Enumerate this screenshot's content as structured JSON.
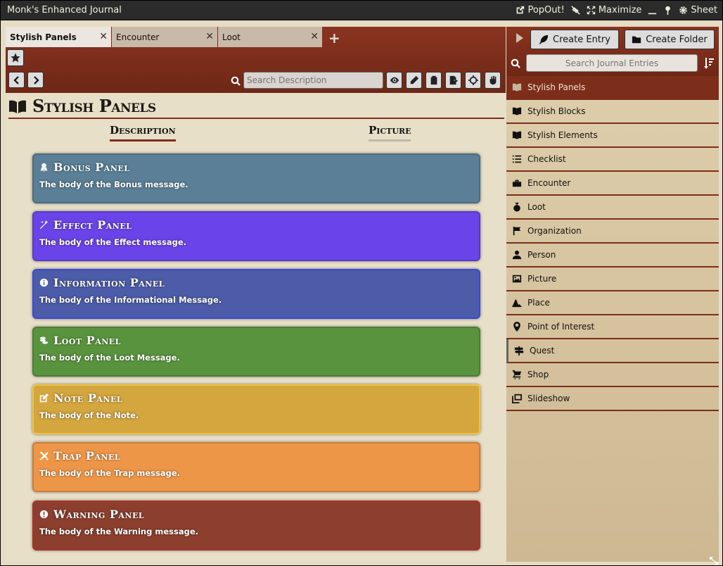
{
  "window": {
    "title": "Monk's Enhanced Journal",
    "header_buttons": [
      "PopOut!",
      "",
      "Maximize",
      "",
      "",
      "Sheet"
    ]
  },
  "tabs": [
    {
      "label": "Stylish Panels"
    },
    {
      "label": "Encounter"
    },
    {
      "label": "Loot"
    }
  ],
  "toolbar": {
    "search_placeholder": "Search Description"
  },
  "page": {
    "title": "Stylish Panels",
    "subtabs": [
      {
        "label": "Description"
      },
      {
        "label": "Picture"
      }
    ]
  },
  "panels": [
    {
      "title": "Bonus Panel",
      "body": "The body of the Bonus message.",
      "color": "#5a7f96",
      "icon": "ribbon-icon"
    },
    {
      "title": "Effect Panel",
      "body": "The body of the Effect message.",
      "color": "#6a44e8",
      "icon": "magic-wand-icon"
    },
    {
      "title": "Information Panel",
      "body": "The body of the Informational Message.",
      "color": "#4d5ca8",
      "icon": "info-icon"
    },
    {
      "title": "Loot Panel",
      "body": "The body of the Loot Message.",
      "color": "#5a933e",
      "icon": "coins-icon"
    },
    {
      "title": "Note Panel",
      "body": "The body of the Note.",
      "color": "#d4a63e",
      "icon": "edit-icon"
    },
    {
      "title": "Trap Panel",
      "body": "The body of the Trap message.",
      "color": "#ee9648",
      "icon": "crossed-swords-icon"
    },
    {
      "title": "Warning Panel",
      "body": "The body of the Warning message.",
      "color": "#8c3f2e",
      "icon": "exclamation-icon"
    }
  ],
  "sidebar": {
    "create_entry": "Create Entry",
    "create_folder": "Create Folder",
    "search_placeholder": "Search Journal Entries",
    "entries": [
      {
        "label": "Stylish Panels",
        "icon": "book-open-icon"
      },
      {
        "label": "Stylish Blocks",
        "icon": "book-open-icon"
      },
      {
        "label": "Stylish Elements",
        "icon": "book-open-icon"
      },
      {
        "label": "Checklist",
        "icon": "list-icon"
      },
      {
        "label": "Encounter",
        "icon": "toolbox-icon"
      },
      {
        "label": "Loot",
        "icon": "money-bag-icon"
      },
      {
        "label": "Organization",
        "icon": "flag-icon"
      },
      {
        "label": "Person",
        "icon": "user-icon"
      },
      {
        "label": "Picture",
        "icon": "image-icon"
      },
      {
        "label": "Place",
        "icon": "place-icon"
      },
      {
        "label": "Point of Interest",
        "icon": "map-pin-icon"
      },
      {
        "label": "Quest",
        "icon": "signpost-icon"
      },
      {
        "label": "Shop",
        "icon": "shop-icon"
      },
      {
        "label": "Slideshow",
        "icon": "images-icon"
      }
    ]
  }
}
